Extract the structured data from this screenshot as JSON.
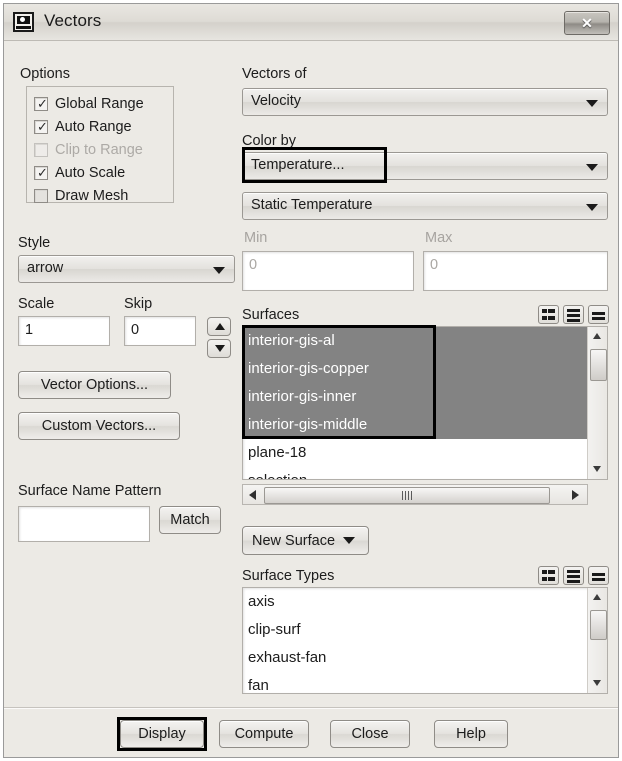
{
  "window": {
    "title": "Vectors",
    "icon": "vectors-app-icon",
    "close_label": "✕"
  },
  "options": {
    "group_label": "Options",
    "items": [
      {
        "label": "Global Range",
        "checked": true,
        "enabled": true
      },
      {
        "label": "Auto Range",
        "checked": true,
        "enabled": true
      },
      {
        "label": "Clip to Range",
        "checked": false,
        "enabled": false
      },
      {
        "label": "Auto Scale",
        "checked": true,
        "enabled": true
      },
      {
        "label": "Draw Mesh",
        "checked": false,
        "enabled": true
      }
    ]
  },
  "style": {
    "label": "Style",
    "value": "arrow"
  },
  "scale": {
    "label": "Scale",
    "value": "1"
  },
  "skip": {
    "label": "Skip",
    "value": "0"
  },
  "left_buttons": {
    "vector_options": "Vector Options...",
    "custom_vectors": "Custom Vectors..."
  },
  "surface_name_pattern": {
    "label": "Surface Name Pattern",
    "value": "",
    "match_label": "Match"
  },
  "vectors_of": {
    "label": "Vectors of",
    "value": "Velocity"
  },
  "color_by": {
    "label": "Color by",
    "value": "Temperature...",
    "sub_value": "Static Temperature",
    "highlighted": true
  },
  "range": {
    "min_label": "Min",
    "min_value": "0",
    "max_label": "Max",
    "max_value": "0",
    "enabled": false
  },
  "surfaces": {
    "label": "Surfaces",
    "tool_icons": [
      "select-filter-icon",
      "select-all-icon",
      "deselect-all-icon"
    ],
    "items": [
      {
        "label": "interior-gis-al",
        "selected": true
      },
      {
        "label": "interior-gis-copper",
        "selected": true
      },
      {
        "label": "interior-gis-inner",
        "selected": true
      },
      {
        "label": "interior-gis-middle",
        "selected": true
      },
      {
        "label": "plane-18",
        "selected": false
      },
      {
        "label": "selection",
        "selected": false
      }
    ],
    "highlighted": true
  },
  "new_surface": {
    "label": "New Surface"
  },
  "surface_types": {
    "label": "Surface Types",
    "tool_icons": [
      "select-filter-icon",
      "select-all-icon",
      "deselect-all-icon"
    ],
    "items": [
      {
        "label": "axis",
        "selected": false
      },
      {
        "label": "clip-surf",
        "selected": false
      },
      {
        "label": "exhaust-fan",
        "selected": false
      },
      {
        "label": "fan",
        "selected": false
      }
    ]
  },
  "footer": {
    "display": "Display",
    "compute": "Compute",
    "close": "Close",
    "help": "Help",
    "display_highlighted": true
  },
  "colors": {
    "dialog_bg": "#eceae5",
    "selection_bg": "#838383",
    "selection_fg": "#ffffff",
    "annotation": "#000000",
    "text": "#1c1c1c",
    "disabled_text": "#a7a4a0"
  }
}
